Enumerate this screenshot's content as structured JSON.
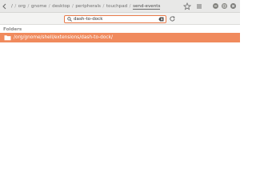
{
  "window": {
    "path": [
      "/",
      "org",
      "gnome",
      "desktop",
      "peripherals",
      "touchpad",
      "send-events"
    ]
  },
  "search": {
    "value": "dash-to-dock"
  },
  "results": {
    "section_label": "Folders",
    "items": [
      {
        "label": "/org/gnome/shell/extensions/dash-to-dock/",
        "icon": "folder-icon"
      }
    ]
  },
  "colors": {
    "accent": "#f08a5d",
    "search_border": "#e97b4a"
  }
}
